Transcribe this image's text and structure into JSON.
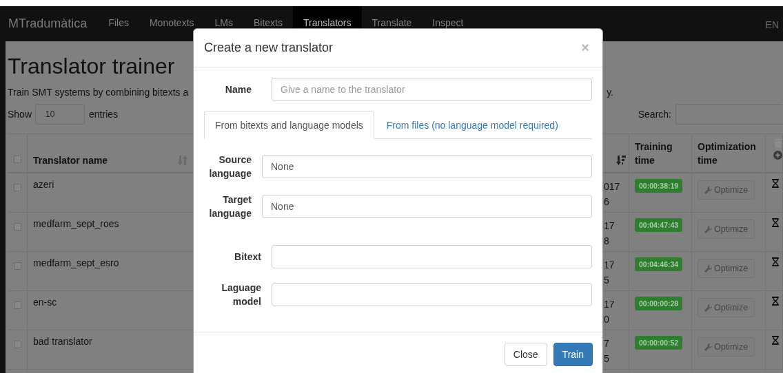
{
  "navbar": {
    "brand": "MTradumàtica",
    "items": [
      {
        "label": "Files",
        "selected": false
      },
      {
        "label": "Monotexts",
        "selected": false
      },
      {
        "label": "LMs",
        "selected": false
      },
      {
        "label": "Bitexts",
        "selected": false
      },
      {
        "label": "Translators",
        "selected": true
      },
      {
        "label": "Translate",
        "selected": false
      },
      {
        "label": "Inspect",
        "selected": false
      }
    ],
    "language": "EN"
  },
  "page": {
    "title": "Translator trainer",
    "description_start": "Train SMT systems by combining bitexts a",
    "description_end": "y."
  },
  "length_menu": {
    "label_before": "Show",
    "value": "10",
    "label_after": "entries"
  },
  "search": {
    "label": "Search:"
  },
  "table": {
    "header_checked": false,
    "columns": [
      {
        "kind": "sortable",
        "label": "Translator name",
        "sorted": false
      },
      {
        "kind": "sortable",
        "sorted": true
      },
      {
        "kind": "plain",
        "label": "Training time"
      },
      {
        "kind": "plain",
        "label": "Optimization time"
      }
    ],
    "rows": [
      {
        "checked": false,
        "name": "azeri",
        "column_3": [
          "017",
          "6"
        ],
        "training_time": "00:00:38:19",
        "action": "Optimize"
      },
      {
        "checked": false,
        "name": "medfarm_sept_roes",
        "column_3": [
          "17",
          "8"
        ],
        "training_time": "00:04:47:43",
        "action": "Optimize"
      },
      {
        "checked": false,
        "name": "medfarm_sept_esro",
        "column_3": [
          "17",
          "5"
        ],
        "training_time": "00:04:46:34",
        "action": "Optimize"
      },
      {
        "checked": false,
        "name": "en-sc",
        "column_3": [
          "17",
          "0"
        ],
        "training_time": "00:00:00:28",
        "action": "Optimize"
      },
      {
        "checked": false,
        "name": "bad translator",
        "column_3": [
          "7",
          "5"
        ],
        "training_time": "00:00:00:52",
        "action": "Optimize"
      }
    ]
  },
  "modal": {
    "title": "Create a new translator",
    "close": "×",
    "name_field": {
      "label": "Name",
      "placeholder": "Give a name to the translator"
    },
    "tabs": [
      {
        "label": "From bitexts and language models",
        "selected": true
      },
      {
        "label": "From files (no language model required)",
        "selected": false
      }
    ],
    "fields": [
      {
        "label": "Source language",
        "value": "None",
        "kind": "select"
      },
      {
        "label": "Target language",
        "value": "None",
        "kind": "select"
      },
      {
        "label": "Bitext",
        "kind": "input"
      },
      {
        "label": "Laguage model",
        "kind": "input"
      }
    ],
    "buttons": [
      {
        "label": "Close",
        "kind": "default"
      },
      {
        "label": "Train",
        "kind": "primary"
      }
    ]
  }
}
